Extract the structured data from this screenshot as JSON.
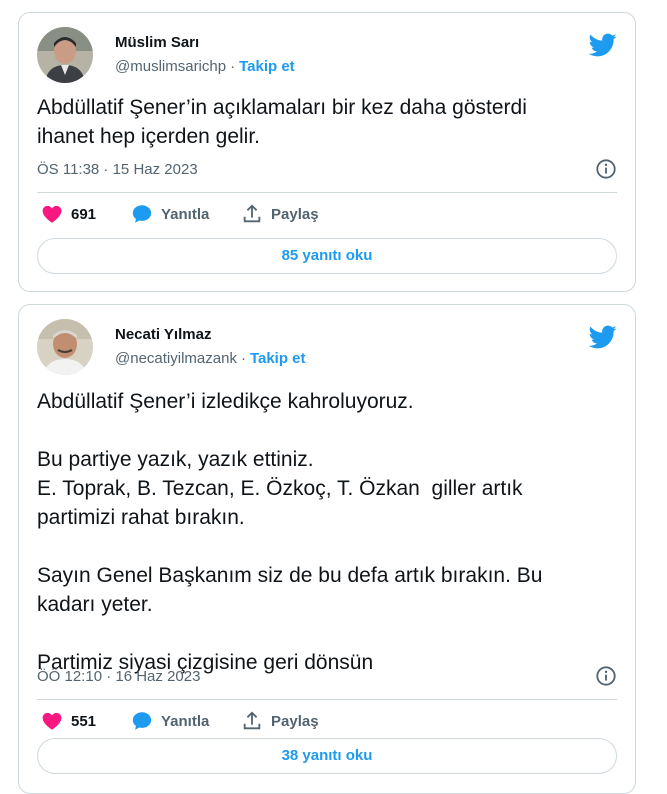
{
  "tweets": [
    {
      "name": "Müslim Sarı",
      "handle": "@muslimsarichp",
      "follow_label": "Takip et",
      "text": "Abdüllatif Şener’in açıklamaları bir kez daha gösterdi\nihanet hep içerden gelir.",
      "timestamp": "ÖS 11:38 · 15 Haz 2023",
      "like_count": "691",
      "reply_label": "Yanıtla",
      "share_label": "Paylaş",
      "replies_button": "85 yanıtı oku"
    },
    {
      "name": "Necati Yılmaz",
      "handle": "@necatiyilmazank",
      "follow_label": "Takip et",
      "text": "Abdüllatif Şener’i izledikçe kahroluyoruz.\n\nBu partiye yazık, yazık ettiniz.\nE. Toprak, B. Tezcan, E. Özkoç, T. Özkan  giller artık\npartimizi rahat bırakın.\n\nSayın Genel Başkanım siz de bu defa artık bırakın. Bu\nkadarı yeter.\n\nPartimiz siyasi çizgisine geri dönsün",
      "timestamp": "ÖÖ 12:10 · 16 Haz 2023",
      "like_count": "551",
      "reply_label": "Yanıtla",
      "share_label": "Paylaş",
      "replies_button": "38 yanıtı oku"
    }
  ],
  "icons": {
    "brand": "twitter-bird-icon",
    "like": "heart-icon",
    "reply": "speech-bubble-icon",
    "share": "share-upload-icon",
    "info": "info-icon"
  },
  "colors": {
    "accent": "#1d9bf0",
    "like": "#f91880",
    "text": "#0f1419",
    "secondary": "#536471",
    "border": "#cfd9de"
  }
}
